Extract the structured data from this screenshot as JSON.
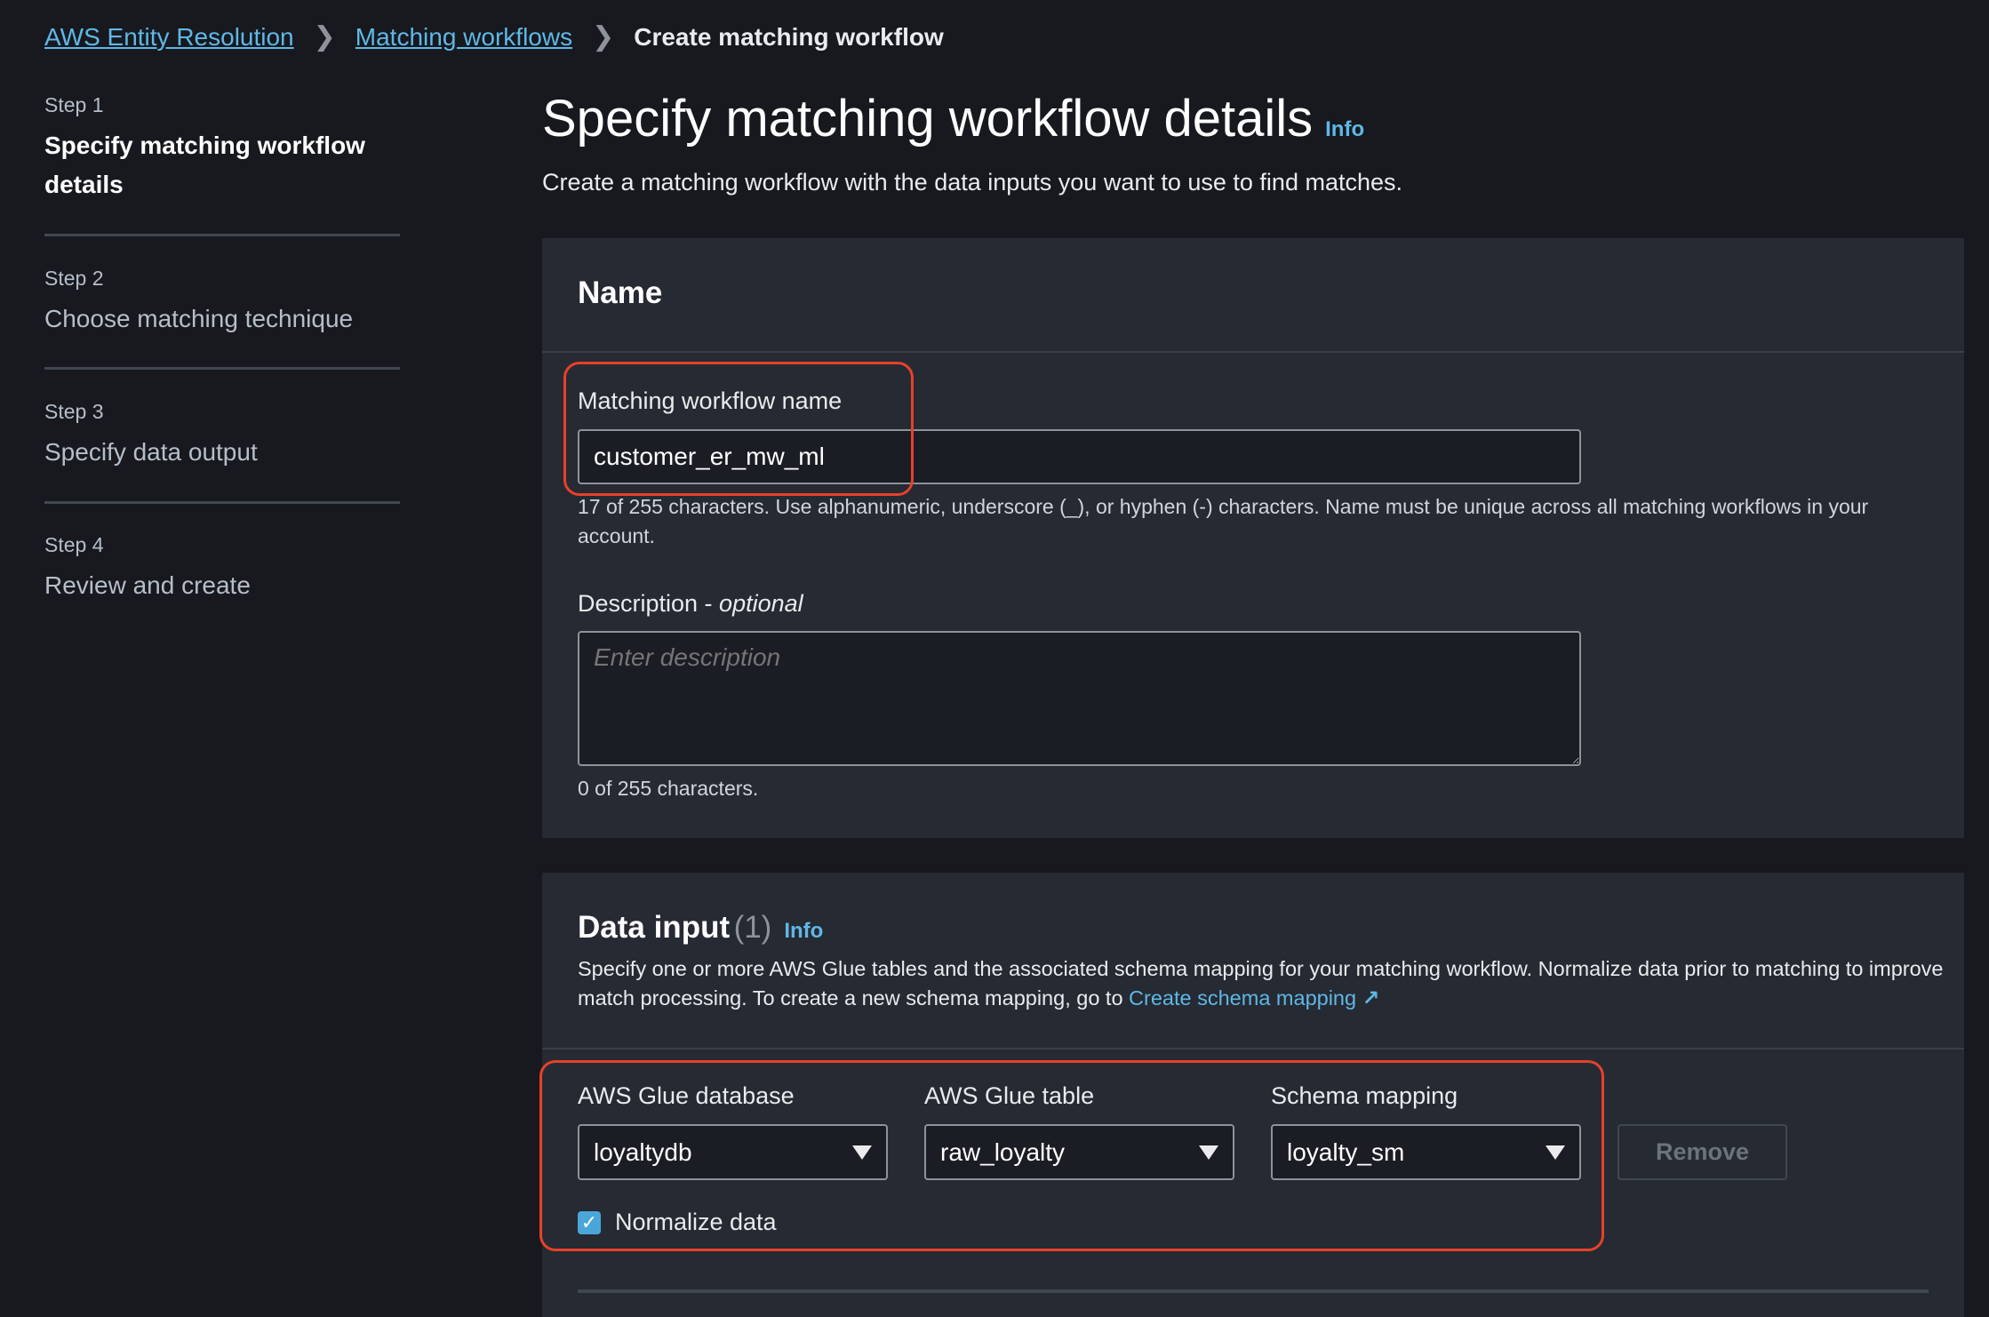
{
  "breadcrumb": {
    "items": [
      "AWS Entity Resolution",
      "Matching workflows"
    ],
    "current": "Create matching workflow"
  },
  "steps": [
    {
      "step": "Step 1",
      "title": "Specify matching workflow details",
      "active": true
    },
    {
      "step": "Step 2",
      "title": "Choose matching technique"
    },
    {
      "step": "Step 3",
      "title": "Specify data output"
    },
    {
      "step": "Step 4",
      "title": "Review and create"
    }
  ],
  "page": {
    "title": "Specify matching workflow details",
    "info": "Info",
    "subtitle": "Create a matching workflow with the data inputs you want to use to find matches."
  },
  "name_section": {
    "header": "Name",
    "name_label": "Matching workflow name",
    "name_value": "customer_er_mw_ml",
    "name_hint": "17 of 255 characters. Use alphanumeric, underscore (_), or hyphen (-) characters. Name must be unique across all matching workflows in your account.",
    "desc_label": "Description - ",
    "desc_optional": "optional",
    "desc_placeholder": "Enter description",
    "desc_hint": "0 of 255 characters."
  },
  "data_input": {
    "header": "Data input",
    "count": "(1)",
    "info": "Info",
    "desc": "Specify one or more AWS Glue tables and the associated schema mapping for your matching workflow. Normalize data prior to matching to improve match processing. To create a new schema mapping, go to ",
    "link": "Create schema mapping",
    "db_label": "AWS Glue database",
    "db_value": "loyaltydb",
    "table_label": "AWS Glue table",
    "table_value": "raw_loyalty",
    "schema_label": "Schema mapping",
    "schema_value": "loyalty_sm",
    "remove": "Remove",
    "normalize": "Normalize data",
    "normalize_checked": true
  },
  "colors": {
    "accent": "#5fb8e6",
    "highlight": "#e8402a"
  }
}
